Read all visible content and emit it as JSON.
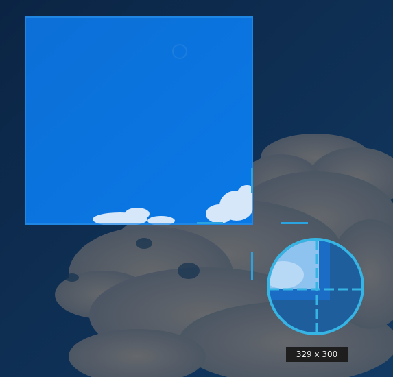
{
  "capture": {
    "size_label": "329 x 300"
  },
  "icons": {
    "crosshair": "crosshair-icon",
    "magnifier": "magnifier-loupe-icon"
  },
  "colors": {
    "crosshair": "#46bef0",
    "selection_border": "#288ce6",
    "loupe_ring": "#36b5e5",
    "badge_bg": "#1e1e1e"
  }
}
